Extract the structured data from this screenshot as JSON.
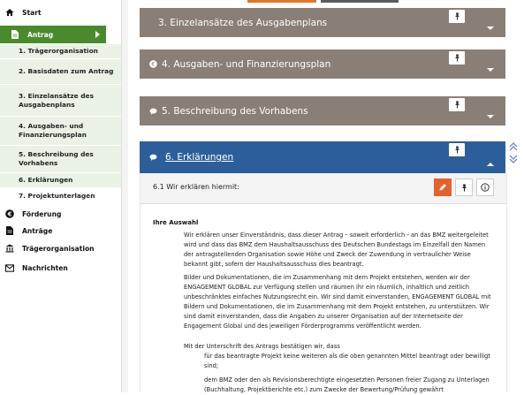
{
  "sidebar": {
    "start": "Start",
    "antrag": "Antrag",
    "submenu": [
      {
        "label": "1. Trägerorganisation"
      },
      {
        "label": "2. Basisdaten zum Antrag"
      },
      {
        "label": "3. Einzelansätze des Ausgabenplans"
      },
      {
        "label": "4. Ausgaben- und Finanzierungsplan"
      },
      {
        "label": "5. Beschreibung des Vorhabens"
      },
      {
        "label": "6. Erklärungen"
      },
      {
        "label": "7. Projektunterlagen"
      }
    ],
    "foerderung": "Förderung",
    "antraege": "Anträge",
    "traegerorganisation": "Trägerorganisation",
    "nachrichten": "Nachrichten"
  },
  "panels": [
    {
      "title": "3. Einzelansätze des Ausgabenplans"
    },
    {
      "title": "4. Ausgaben- und Finanzierungsplan"
    },
    {
      "title": "5. Beschreibung des Vorhabens"
    },
    {
      "title": "6. Erklärungen"
    }
  ],
  "declaration": {
    "label": "6.1 Wir erklären hiermit:",
    "selection_title": "Ihre Auswahl",
    "paragraphs": [
      "Wir erklären unser Einverständnis, dass dieser Antrag – soweit erforderlich - an das BMZ weitergeleitet wird und dass das BMZ dem Haushaltsausschuss des Deutschen Bundestags im Einzelfall den Namen der antragstellenden Organisation sowie Höhe und Zweck der Zuwendung in vertraulicher Weise bekannt gibt, sofern der Haushaltsausschuss dies beantragt.",
      "Bilder und Dokumentationen, die im Zusammenhang mit dem Projekt entstehen, werden wir der ENGAGEMENT GLOBAL zur Verfügung stellen und räumen ihr ein räumlich, inhaltlich und zeitlich unbeschränktes einfaches Nutzungsrecht ein. Wir sind damit einverstanden, ENGAGEMENT GLOBAL mit Bildern und Dokumentationen, die im Zusammenhang mit dem Projekt entstehen, zu unterstützen. Wir sind damit einverstanden, dass die Angaben zu unserer Organisation auf der Internetseite der Engagement Global und des jeweiligen Förderprogramms veröffentlicht werden.",
      "Mit der Unterschrift des Antrags bestätigen wir, dass"
    ],
    "sub_paragraphs": [
      "für das beantragte Projekt keine weiteren als die oben genannten Mittel beantragt oder bewilligt sind;",
      "dem BMZ oder den als Revisionsberechtigte eingesetzten Personen freier Zugang zu Unterlagen (Buchhaltung, Projektberichte etc.) zum Zwecke der Bewertung/Prüfung gewährt"
    ]
  },
  "colors": {
    "sidebar_active": "#4a8a2c",
    "submenu_bg": "#eaf2e6",
    "panel_collapsed": "#8a7f76",
    "panel_active": "#2c5f99",
    "edit_button": "#e2632d"
  }
}
